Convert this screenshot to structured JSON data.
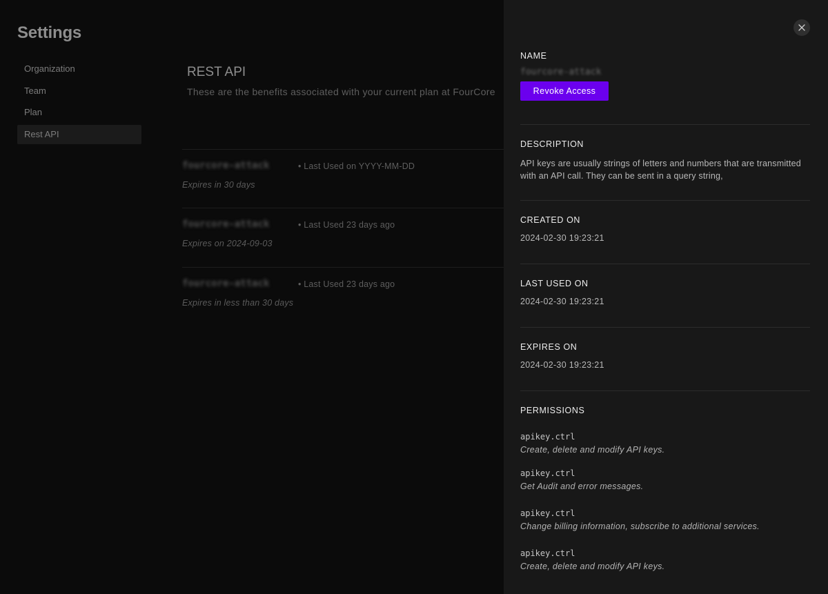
{
  "settings": {
    "title": "Settings",
    "nav": [
      {
        "label": "Organization"
      },
      {
        "label": "Team"
      },
      {
        "label": "Plan"
      },
      {
        "label": "Rest API",
        "active": true
      }
    ]
  },
  "main": {
    "title": "REST API",
    "subtitle": "These are the benefits associated with your current plan at FourCore",
    "keys": [
      {
        "name": "fourcore-attack",
        "last_used": "• Last Used on YYYY-MM-DD",
        "expires": "Expires in 30 days"
      },
      {
        "name": "fourcore-attack",
        "last_used": "• Last Used 23 days ago",
        "expires": "Expires on 2024-09-03"
      },
      {
        "name": "fourcore-attack",
        "last_used": "• Last Used 23 days ago",
        "expires": "Expires in less than 30 days"
      }
    ]
  },
  "drawer": {
    "close_icon": "close-icon",
    "name_label": "NAME",
    "name_value": "fourcore-attack",
    "revoke_label": "Revoke Access",
    "accent_color": "#6b00ee",
    "description_label": "DESCRIPTION",
    "description_text": "API keys are usually strings of letters and numbers that are transmitted with an API call. They can be sent in a query string,",
    "created_label": "CREATED ON",
    "created_value": "2024-02-30 19:23:21",
    "last_used_label": "LAST USED ON",
    "last_used_value": "2024-02-30 19:23:21",
    "expires_label": "EXPIRES ON",
    "expires_value": "2024-02-30 19:23:21",
    "permissions_label": "PERMISSIONS",
    "permissions": [
      {
        "key": "apikey.ctrl",
        "desc": "Create, delete and modify API keys."
      },
      {
        "key": "apikey.ctrl",
        "desc": "Get Audit and error messages."
      },
      {
        "key": "apikey.ctrl",
        "desc": "Change billing information, subscribe to additional services."
      },
      {
        "key": "apikey.ctrl",
        "desc": "Create, delete and modify API keys."
      }
    ]
  }
}
